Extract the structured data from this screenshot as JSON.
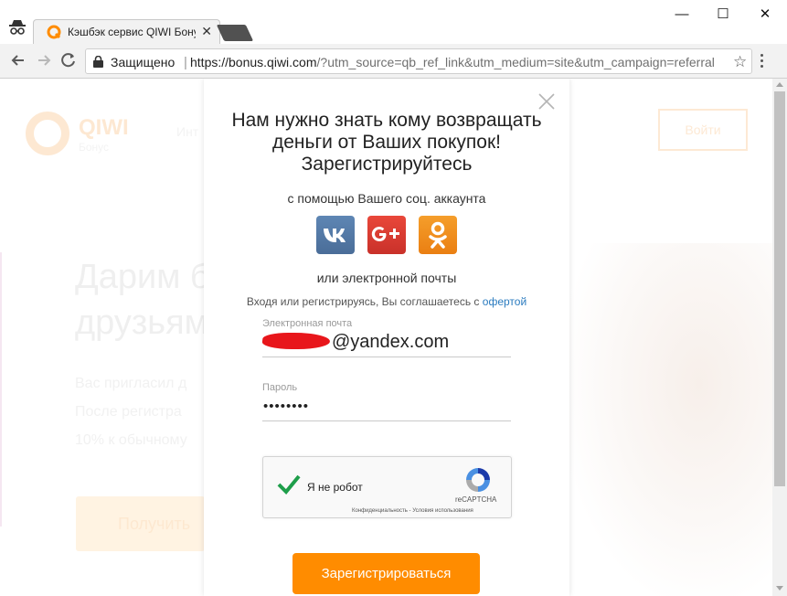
{
  "browser": {
    "tab_title": "Кэшбэк сервис QIWI Бонус",
    "tab_close": "✕",
    "window_controls": {
      "minimize": "—",
      "maximize": "☐",
      "close": "✕"
    },
    "secure_label": "Защищено",
    "url_host": "https://bonus.qiwi.com",
    "url_rest": "/?utm_source=qb_ref_link&utm_medium=site&utm_campaign=referral",
    "star": "☆"
  },
  "background_page": {
    "brand": "QIWI",
    "brand_sub": "Бонус",
    "nav_fragment": "Инт",
    "login_button": "Войти",
    "heading": "Дарим б\nдрузьям",
    "body_text": "Вас пригласил д\nПосле регистра\n10% к обычному",
    "cta_button": "Получить"
  },
  "modal": {
    "close": "×",
    "title": "Нам нужно знать кому возвращать деньги от Ваших покупок! Зарегистрируйтесь",
    "social_label": "с помощью Вашего соц. аккаунта",
    "social_icons": [
      "vk-icon",
      "google-plus-icon",
      "odnoklassniki-icon"
    ],
    "email_option_label": "или электронной почты",
    "terms_text": "Входя или регистрируясь, Вы соглашаетесь с",
    "terms_link": "офертой",
    "email": {
      "label": "Электронная почта",
      "value_suffix": "@yandex.com"
    },
    "password": {
      "label": "Пароль",
      "value": "••••••••"
    },
    "captcha": {
      "label": "Я не робот",
      "brand": "reCAPTCHA",
      "links": "Конфиденциальность - Условия использования",
      "checked": true
    },
    "submit_label": "Зарегистрироваться",
    "accent_color": "#ff8c00"
  }
}
